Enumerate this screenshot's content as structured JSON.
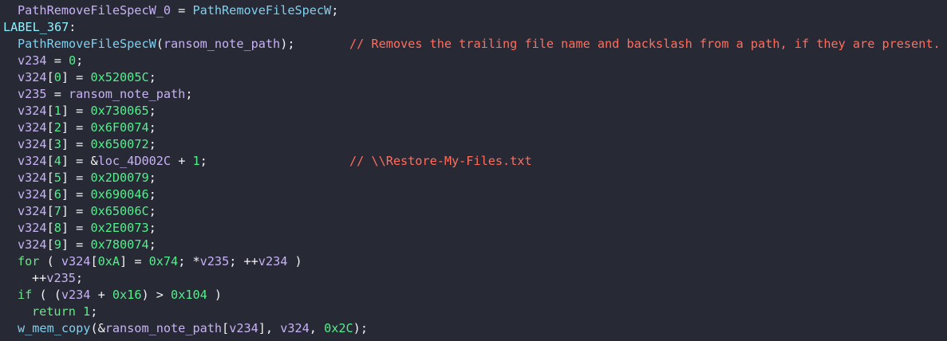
{
  "code": {
    "lines": [
      {
        "indent": 1,
        "tokens": [
          {
            "t": "PathRemoveFileSpecW_0",
            "c": "var"
          },
          {
            "t": " = ",
            "c": "punc"
          },
          {
            "t": "PathRemoveFileSpecW",
            "c": "fn"
          },
          {
            "t": ";",
            "c": "punc"
          }
        ]
      },
      {
        "indent": 0,
        "tokens": [
          {
            "t": "LABEL_367",
            "c": "label"
          },
          {
            "t": ":",
            "c": "punc"
          }
        ]
      },
      {
        "indent": 1,
        "tokens": [
          {
            "t": "PathRemoveFileSpecW",
            "c": "fn"
          },
          {
            "t": "(",
            "c": "punc"
          },
          {
            "t": "ransom_note_path",
            "c": "var"
          },
          {
            "t": ");",
            "c": "punc"
          }
        ],
        "comment": "// Removes the trailing file name and backslash from a path, if they are present."
      },
      {
        "indent": 1,
        "tokens": [
          {
            "t": "v234",
            "c": "var"
          },
          {
            "t": " = ",
            "c": "punc"
          },
          {
            "t": "0",
            "c": "num"
          },
          {
            "t": ";",
            "c": "punc"
          }
        ]
      },
      {
        "indent": 1,
        "tokens": [
          {
            "t": "v324",
            "c": "var"
          },
          {
            "t": "[",
            "c": "punc"
          },
          {
            "t": "0",
            "c": "num"
          },
          {
            "t": "] = ",
            "c": "punc"
          },
          {
            "t": "0x52005C",
            "c": "num"
          },
          {
            "t": ";",
            "c": "punc"
          }
        ]
      },
      {
        "indent": 1,
        "tokens": [
          {
            "t": "v235",
            "c": "var"
          },
          {
            "t": " = ",
            "c": "punc"
          },
          {
            "t": "ransom_note_path",
            "c": "var"
          },
          {
            "t": ";",
            "c": "punc"
          }
        ]
      },
      {
        "indent": 1,
        "tokens": [
          {
            "t": "v324",
            "c": "var"
          },
          {
            "t": "[",
            "c": "punc"
          },
          {
            "t": "1",
            "c": "num"
          },
          {
            "t": "] = ",
            "c": "punc"
          },
          {
            "t": "0x730065",
            "c": "num"
          },
          {
            "t": ";",
            "c": "punc"
          }
        ]
      },
      {
        "indent": 1,
        "tokens": [
          {
            "t": "v324",
            "c": "var"
          },
          {
            "t": "[",
            "c": "punc"
          },
          {
            "t": "2",
            "c": "num"
          },
          {
            "t": "] = ",
            "c": "punc"
          },
          {
            "t": "0x6F0074",
            "c": "num"
          },
          {
            "t": ";",
            "c": "punc"
          }
        ]
      },
      {
        "indent": 1,
        "tokens": [
          {
            "t": "v324",
            "c": "var"
          },
          {
            "t": "[",
            "c": "punc"
          },
          {
            "t": "3",
            "c": "num"
          },
          {
            "t": "] = ",
            "c": "punc"
          },
          {
            "t": "0x650072",
            "c": "num"
          },
          {
            "t": ";",
            "c": "punc"
          }
        ]
      },
      {
        "indent": 1,
        "tokens": [
          {
            "t": "v324",
            "c": "var"
          },
          {
            "t": "[",
            "c": "punc"
          },
          {
            "t": "4",
            "c": "num"
          },
          {
            "t": "] = &",
            "c": "punc"
          },
          {
            "t": "loc_4D002C",
            "c": "var"
          },
          {
            "t": " + ",
            "c": "punc"
          },
          {
            "t": "1",
            "c": "num"
          },
          {
            "t": ";",
            "c": "punc"
          }
        ],
        "comment": "// \\\\Restore-My-Files.txt"
      },
      {
        "indent": 1,
        "tokens": [
          {
            "t": "v324",
            "c": "var"
          },
          {
            "t": "[",
            "c": "punc"
          },
          {
            "t": "5",
            "c": "num"
          },
          {
            "t": "] = ",
            "c": "punc"
          },
          {
            "t": "0x2D0079",
            "c": "num"
          },
          {
            "t": ";",
            "c": "punc"
          }
        ]
      },
      {
        "indent": 1,
        "tokens": [
          {
            "t": "v324",
            "c": "var"
          },
          {
            "t": "[",
            "c": "punc"
          },
          {
            "t": "6",
            "c": "num"
          },
          {
            "t": "] = ",
            "c": "punc"
          },
          {
            "t": "0x690046",
            "c": "num"
          },
          {
            "t": ";",
            "c": "punc"
          }
        ]
      },
      {
        "indent": 1,
        "tokens": [
          {
            "t": "v324",
            "c": "var"
          },
          {
            "t": "[",
            "c": "punc"
          },
          {
            "t": "7",
            "c": "num"
          },
          {
            "t": "] = ",
            "c": "punc"
          },
          {
            "t": "0x65006C",
            "c": "num"
          },
          {
            "t": ";",
            "c": "punc"
          }
        ]
      },
      {
        "indent": 1,
        "tokens": [
          {
            "t": "v324",
            "c": "var"
          },
          {
            "t": "[",
            "c": "punc"
          },
          {
            "t": "8",
            "c": "num"
          },
          {
            "t": "] = ",
            "c": "punc"
          },
          {
            "t": "0x2E0073",
            "c": "num"
          },
          {
            "t": ";",
            "c": "punc"
          }
        ]
      },
      {
        "indent": 1,
        "tokens": [
          {
            "t": "v324",
            "c": "var"
          },
          {
            "t": "[",
            "c": "punc"
          },
          {
            "t": "9",
            "c": "num"
          },
          {
            "t": "] = ",
            "c": "punc"
          },
          {
            "t": "0x780074",
            "c": "num"
          },
          {
            "t": ";",
            "c": "punc"
          }
        ]
      },
      {
        "indent": 1,
        "tokens": [
          {
            "t": "for",
            "c": "kw"
          },
          {
            "t": " ( ",
            "c": "punc"
          },
          {
            "t": "v324",
            "c": "var"
          },
          {
            "t": "[",
            "c": "punc"
          },
          {
            "t": "0xA",
            "c": "num"
          },
          {
            "t": "] = ",
            "c": "punc"
          },
          {
            "t": "0x74",
            "c": "num"
          },
          {
            "t": "; *",
            "c": "punc"
          },
          {
            "t": "v235",
            "c": "var"
          },
          {
            "t": "; ++",
            "c": "punc"
          },
          {
            "t": "v234",
            "c": "var"
          },
          {
            "t": " )",
            "c": "punc"
          }
        ]
      },
      {
        "indent": 2,
        "tokens": [
          {
            "t": "++",
            "c": "punc"
          },
          {
            "t": "v235",
            "c": "var"
          },
          {
            "t": ";",
            "c": "punc"
          }
        ]
      },
      {
        "indent": 1,
        "tokens": [
          {
            "t": "if",
            "c": "kw"
          },
          {
            "t": " ( (",
            "c": "punc"
          },
          {
            "t": "v234",
            "c": "var"
          },
          {
            "t": " + ",
            "c": "punc"
          },
          {
            "t": "0x16",
            "c": "num"
          },
          {
            "t": ") > ",
            "c": "punc"
          },
          {
            "t": "0x104",
            "c": "num"
          },
          {
            "t": " )",
            "c": "punc"
          }
        ]
      },
      {
        "indent": 2,
        "tokens": [
          {
            "t": "return",
            "c": "kw"
          },
          {
            "t": " ",
            "c": "punc"
          },
          {
            "t": "1",
            "c": "num"
          },
          {
            "t": ";",
            "c": "punc"
          }
        ]
      },
      {
        "indent": 1,
        "tokens": [
          {
            "t": "w_mem_copy",
            "c": "fn"
          },
          {
            "t": "(&",
            "c": "punc"
          },
          {
            "t": "ransom_note_path",
            "c": "var"
          },
          {
            "t": "[",
            "c": "punc"
          },
          {
            "t": "v234",
            "c": "var"
          },
          {
            "t": "], ",
            "c": "punc"
          },
          {
            "t": "v324",
            "c": "var"
          },
          {
            "t": ", ",
            "c": "punc"
          },
          {
            "t": "0x2C",
            "c": "num"
          },
          {
            "t": ");",
            "c": "punc"
          }
        ]
      }
    ]
  },
  "colors": {
    "background": "#272935",
    "function": "#7fd0ef",
    "variable": "#c8b2f5",
    "number": "#52f08a",
    "keyword": "#6ee38a",
    "punctuation": "#f3f3f5",
    "comment": "#ff6e5e"
  }
}
